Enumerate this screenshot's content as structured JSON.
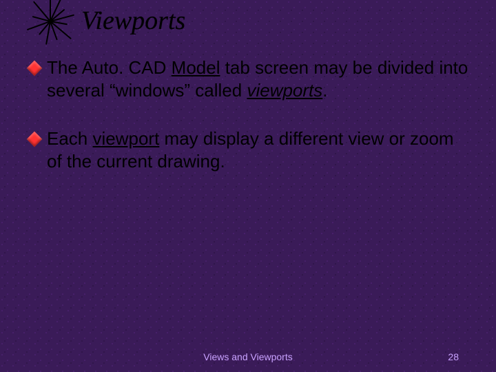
{
  "title": "Viewports",
  "bullets": [
    {
      "pre": "The Auto. CAD ",
      "underline": "Model",
      "mid": " tab screen may be divided into several “windows” called ",
      "italic_underline": "viewports",
      "post": "."
    },
    {
      "pre": "Each ",
      "underline": "viewport",
      "mid": " may display a different view or zoom of the current drawing.",
      "italic_underline": "",
      "post": ""
    }
  ],
  "footer": {
    "center": "Views and Viewports",
    "page_number": "28"
  },
  "colors": {
    "background": "#3a1b58",
    "bullet": "#ff3333",
    "footer_text": "#c9a2ff",
    "body_text": "#000000"
  }
}
